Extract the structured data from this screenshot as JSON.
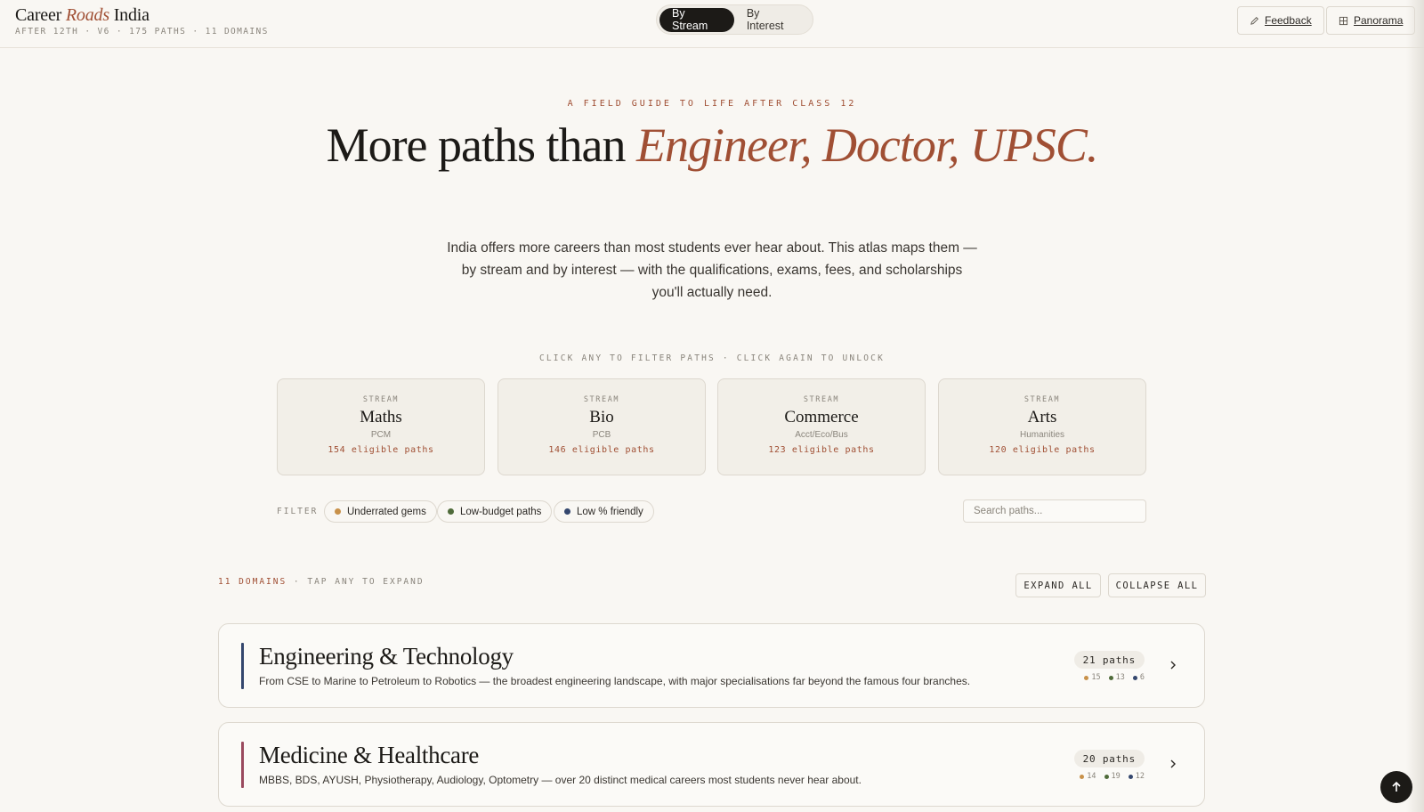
{
  "header": {
    "brand_pre": "Career ",
    "brand_accent": "Roads",
    "brand_post": " India",
    "subtitle": "AFTER 12TH · V6 · 175 PATHS · 11 DOMAINS",
    "toggle": [
      "By Stream",
      "By Interest"
    ],
    "toggle_active": "By Stream",
    "feedback_label": "Feedback",
    "panorama_label": "Panorama"
  },
  "hero": {
    "eyebrow": "A FIELD GUIDE TO LIFE AFTER CLASS 12",
    "title_plain": "More paths than ",
    "title_accent": "Engineer, Doctor, UPSC.",
    "description": "India offers more careers than most students ever hear about. This atlas maps them — by stream and by interest — with the qualifications, exams, fees, and scholarships you'll actually need."
  },
  "streams": {
    "hint": "CLICK ANY TO FILTER PATHS · CLICK AGAIN TO UNLOCK",
    "cards": [
      {
        "kicker": "STREAM",
        "name": "Maths",
        "sub": "PCM",
        "count": "154 eligible paths"
      },
      {
        "kicker": "STREAM",
        "name": "Bio",
        "sub": "PCB",
        "count": "146 eligible paths"
      },
      {
        "kicker": "STREAM",
        "name": "Commerce",
        "sub": "Acct/Eco/Bus",
        "count": "123 eligible paths"
      },
      {
        "kicker": "STREAM",
        "name": "Arts",
        "sub": "Humanities",
        "count": "120 eligible paths"
      }
    ]
  },
  "filters": {
    "label": "FILTER",
    "chips": [
      {
        "label": "Underrated gems",
        "color": "#c8914a"
      },
      {
        "label": "Low-budget paths",
        "color": "#4f6b3a"
      },
      {
        "label": "Low % friendly",
        "color": "#34476e"
      }
    ],
    "search_placeholder": "Search paths..."
  },
  "domains": {
    "count_label": "11 DOMAINS",
    "hint": " · TAP ANY TO EXPAND",
    "expand_all": "EXPAND ALL",
    "collapse_all": "COLLAPSE ALL",
    "items": [
      {
        "title": "Engineering & Technology",
        "description": "From CSE to Marine to Petroleum to Robotics — the broadest engineering landscape, with major specialisations far beyond the famous four branches.",
        "paths": "21 paths",
        "stats": [
          "15",
          "13",
          "6"
        ],
        "accent": "#34476e"
      },
      {
        "title": "Medicine & Healthcare",
        "description": "MBBS, BDS, AYUSH, Physiotherapy, Audiology, Optometry — over 20 distinct medical careers most students never hear about.",
        "paths": "20 paths",
        "stats": [
          "14",
          "19",
          "12"
        ],
        "accent": "#9a4a5e"
      }
    ]
  },
  "colors": {
    "accent": "#a04f34",
    "gem": "#c8914a",
    "budget": "#4f6b3a",
    "percent": "#34476e"
  }
}
